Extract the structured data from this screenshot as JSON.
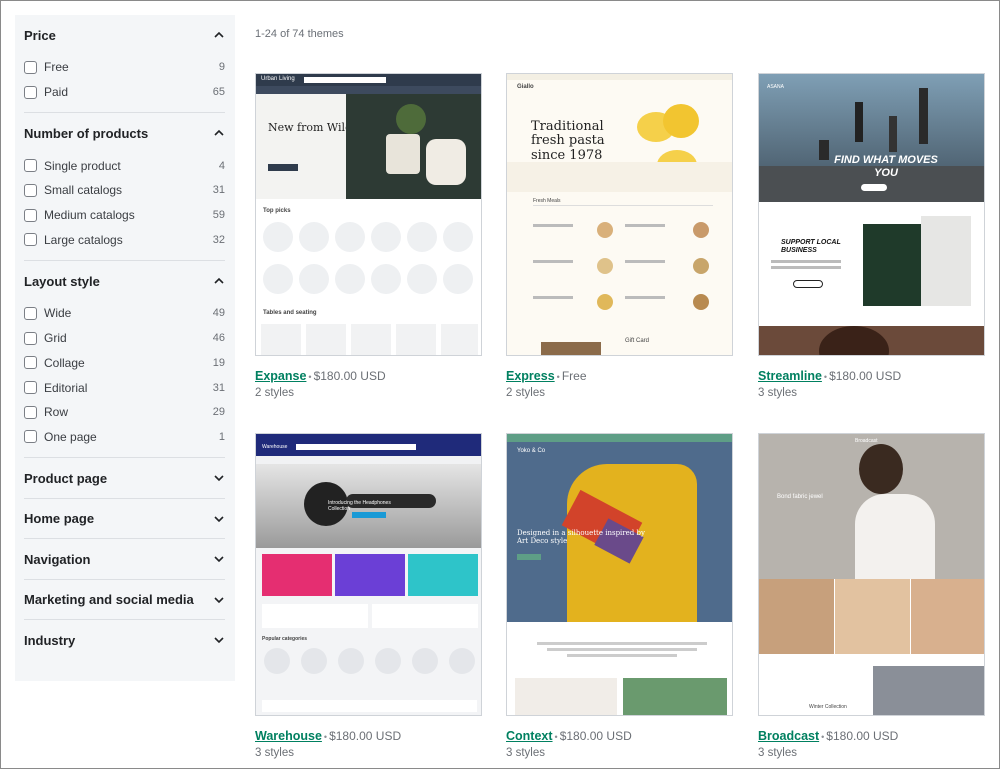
{
  "filters": {
    "price": {
      "title": "Price",
      "options": [
        {
          "label": "Free",
          "count": "9"
        },
        {
          "label": "Paid",
          "count": "65"
        }
      ]
    },
    "products": {
      "title": "Number of products",
      "options": [
        {
          "label": "Single product",
          "count": "4"
        },
        {
          "label": "Small catalogs",
          "count": "31"
        },
        {
          "label": "Medium catalogs",
          "count": "59"
        },
        {
          "label": "Large catalogs",
          "count": "32"
        }
      ]
    },
    "layout": {
      "title": "Layout style",
      "options": [
        {
          "label": "Wide",
          "count": "49"
        },
        {
          "label": "Grid",
          "count": "46"
        },
        {
          "label": "Collage",
          "count": "19"
        },
        {
          "label": "Editorial",
          "count": "31"
        },
        {
          "label": "Row",
          "count": "29"
        },
        {
          "label": "One page",
          "count": "1"
        }
      ]
    },
    "collapsed": [
      "Product page",
      "Home page",
      "Navigation",
      "Marketing and social media",
      "Industry"
    ]
  },
  "results": {
    "count_text": "1-24 of 74 themes"
  },
  "themes": [
    {
      "name": "Expanse",
      "price": "$180.00 USD",
      "styles": "2 styles",
      "thumb": {
        "brand": "Urban Living",
        "headline": "New from Wild Wood",
        "section": "Top picks",
        "section2": "Tables and seating"
      }
    },
    {
      "name": "Express",
      "price": "Free",
      "styles": "2 styles",
      "thumb": {
        "brand": "Giallo",
        "headline": "Traditional fresh pasta since 1978",
        "tab": "Fresh Meals",
        "footer": "Gift Card"
      }
    },
    {
      "name": "Streamline",
      "price": "$180.00 USD",
      "styles": "3 styles",
      "thumb": {
        "brand": "ASANA",
        "headline": "FIND WHAT MOVES YOU",
        "sub": "SUPPORT LOCAL BUSINESS"
      }
    },
    {
      "name": "Warehouse",
      "price": "$180.00 USD",
      "styles": "3 styles",
      "thumb": {
        "brand": "Warehouse",
        "headline": "Introducing the Headphones Collection",
        "section": "Popular categories"
      }
    },
    {
      "name": "Context",
      "price": "$180.00 USD",
      "styles": "3 styles",
      "thumb": {
        "brand": "Yoko & Co",
        "headline": "Designed in a silhouette inspired by Art Deco style"
      }
    },
    {
      "name": "Broadcast",
      "price": "$180.00 USD",
      "styles": "3 styles",
      "thumb": {
        "brand": "Broadcast",
        "headline": "Bond fabric jewel",
        "sub": "Winter Collection"
      }
    }
  ]
}
